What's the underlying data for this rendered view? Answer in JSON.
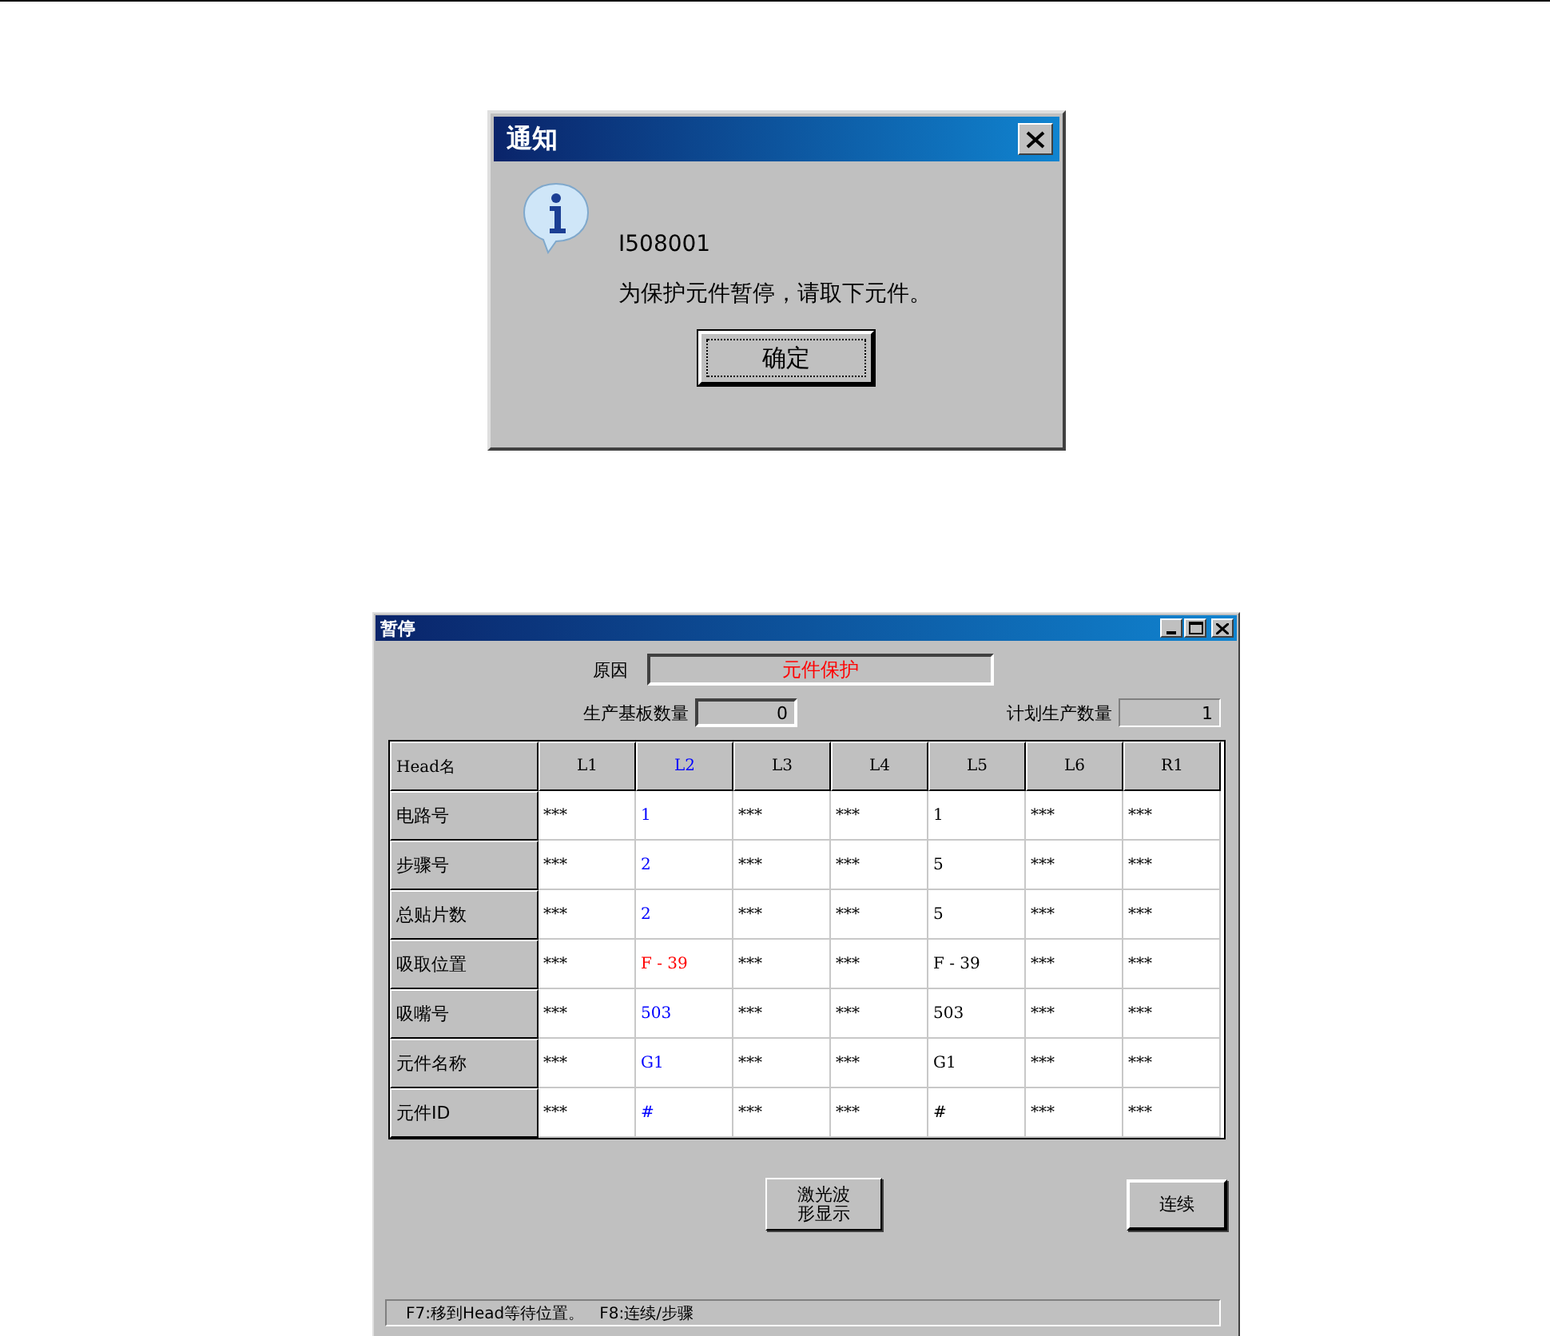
{
  "notice_dialog": {
    "title": "通知",
    "code": "I508001",
    "message": "为保护元件暂停，请取下元件。",
    "ok_button": "确定"
  },
  "pause_window": {
    "title": "暂停",
    "reason": {
      "label": "原因",
      "value": "元件保护"
    },
    "produced_count": {
      "label": "生产基板数量",
      "value": "0"
    },
    "planned_count": {
      "label": "计划生产数量",
      "value": "1"
    },
    "table": {
      "corner": "Head名",
      "columns": [
        {
          "label": "L1",
          "selected": false
        },
        {
          "label": "L2",
          "selected": true
        },
        {
          "label": "L3",
          "selected": false
        },
        {
          "label": "L4",
          "selected": false
        },
        {
          "label": "L5",
          "selected": false
        },
        {
          "label": "L6",
          "selected": false
        },
        {
          "label": "R1",
          "selected": false
        }
      ],
      "rows": [
        {
          "label": "电路号",
          "alert": false,
          "cells": [
            "***",
            "1",
            "***",
            "***",
            "1",
            "***",
            "***"
          ]
        },
        {
          "label": "步骤号",
          "alert": false,
          "cells": [
            "***",
            "2",
            "***",
            "***",
            "5",
            "***",
            "***"
          ]
        },
        {
          "label": "总贴片数",
          "alert": false,
          "cells": [
            "***",
            "2",
            "***",
            "***",
            "5",
            "***",
            "***"
          ]
        },
        {
          "label": "吸取位置",
          "alert": true,
          "cells": [
            "***",
            "F - 39",
            "***",
            "***",
            "F - 39",
            "***",
            "***"
          ]
        },
        {
          "label": "吸嘴号",
          "alert": false,
          "cells": [
            "***",
            "503",
            "***",
            "***",
            "503",
            "***",
            "***"
          ]
        },
        {
          "label": "元件名称",
          "alert": false,
          "cells": [
            "***",
            "G1",
            "***",
            "***",
            "G1",
            "***",
            "***"
          ]
        },
        {
          "label": "元件ID",
          "alert": false,
          "cells": [
            "***",
            "#",
            "***",
            "***",
            "#",
            "***",
            "***"
          ]
        }
      ]
    },
    "buttons": [
      "激光波形显示",
      "连续"
    ],
    "status_bar": "F7:移到Head等待位置。   F8:连续/步骤"
  }
}
